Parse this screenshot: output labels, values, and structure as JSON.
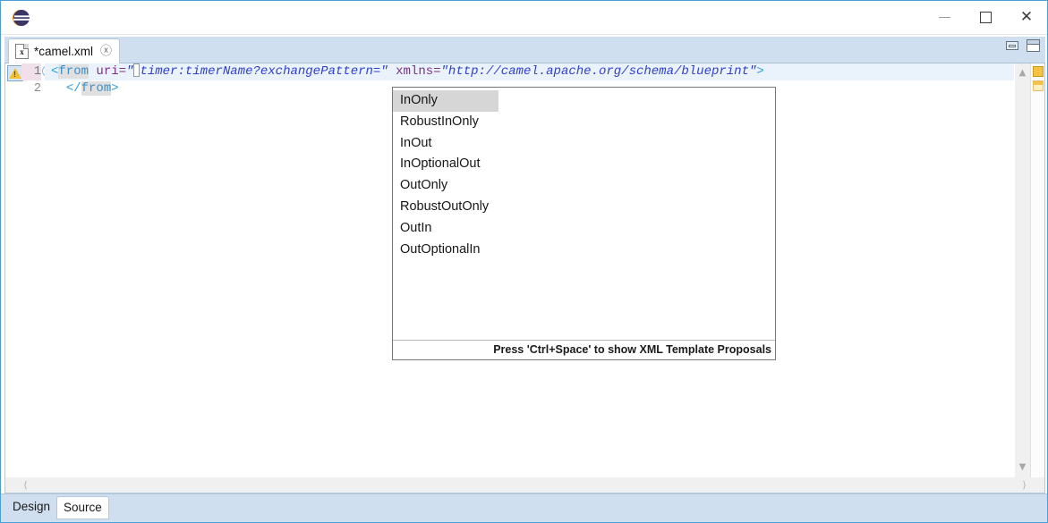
{
  "window": {
    "controls": {
      "minimize": "minimize",
      "maximize": "maximize",
      "close": "close"
    },
    "logo_icon": "eclipse-logo-icon"
  },
  "editor_tabbar": {
    "tab": {
      "icon": "xml-file-icon",
      "label": "*camel.xml",
      "close_icon": "close-tab-icon"
    },
    "controls": {
      "minimize_view": "minimize-view-icon",
      "maximize_view": "maximize-view-icon"
    }
  },
  "editor": {
    "annotation_icon": "warning-triangle-icon",
    "fold_icon": "collapse-fold-icon",
    "line_numbers": [
      "1",
      "2"
    ],
    "lines": [
      {
        "number": "1",
        "current": true,
        "tokens": [
          {
            "type": "punct",
            "text": "<"
          },
          {
            "type": "tag",
            "text": "from"
          },
          {
            "type": "plain",
            "text": " "
          },
          {
            "type": "attr",
            "text": "uri"
          },
          {
            "type": "eq",
            "text": "="
          },
          {
            "type": "quote",
            "text": "\""
          },
          {
            "type": "caret",
            "text": ""
          },
          {
            "type": "str",
            "text": "timer:timerName?exchangePattern=\""
          },
          {
            "type": "plain",
            "text": " "
          },
          {
            "type": "attr",
            "text": "xmlns"
          },
          {
            "type": "eq",
            "text": "="
          },
          {
            "type": "str",
            "text": "\"http://camel.apache.org/schema/blueprint\""
          },
          {
            "type": "punct",
            "text": ">"
          }
        ]
      },
      {
        "number": "2",
        "current": false,
        "tokens": [
          {
            "type": "punct",
            "text": "</"
          },
          {
            "type": "tag",
            "text": "from"
          },
          {
            "type": "punct",
            "text": ">"
          }
        ]
      }
    ],
    "scrollbar": {
      "up_icon": "scroll-up-icon",
      "down_icon": "scroll-down-icon",
      "left_icon": "scroll-left-icon",
      "right_icon": "scroll-right-icon"
    },
    "overview_markers": [
      "warning-marker",
      "warning-marker-secondary"
    ]
  },
  "autocomplete": {
    "items": [
      {
        "label": "InOnly",
        "selected": true
      },
      {
        "label": "RobustInOnly",
        "selected": false
      },
      {
        "label": "InOut",
        "selected": false
      },
      {
        "label": "InOptionalOut",
        "selected": false
      },
      {
        "label": "OutOnly",
        "selected": false
      },
      {
        "label": "RobustOutOnly",
        "selected": false
      },
      {
        "label": "OutIn",
        "selected": false
      },
      {
        "label": "OutOptionalIn",
        "selected": false
      }
    ],
    "footer": "Press 'Ctrl+Space' to show XML Template Proposals"
  },
  "bottom_tabs": [
    {
      "label": "Design",
      "active": false
    },
    {
      "label": "Source",
      "active": true
    }
  ],
  "colors": {
    "accent": "#4a9fd8",
    "tabbar": "#cfdfef",
    "current_line": "#eaf3fb",
    "selection": "#d6d6d6",
    "warning": "#f6c243",
    "tag": "#3a8fcb",
    "attr": "#7d2f8e",
    "string": "#2f3fd0"
  }
}
